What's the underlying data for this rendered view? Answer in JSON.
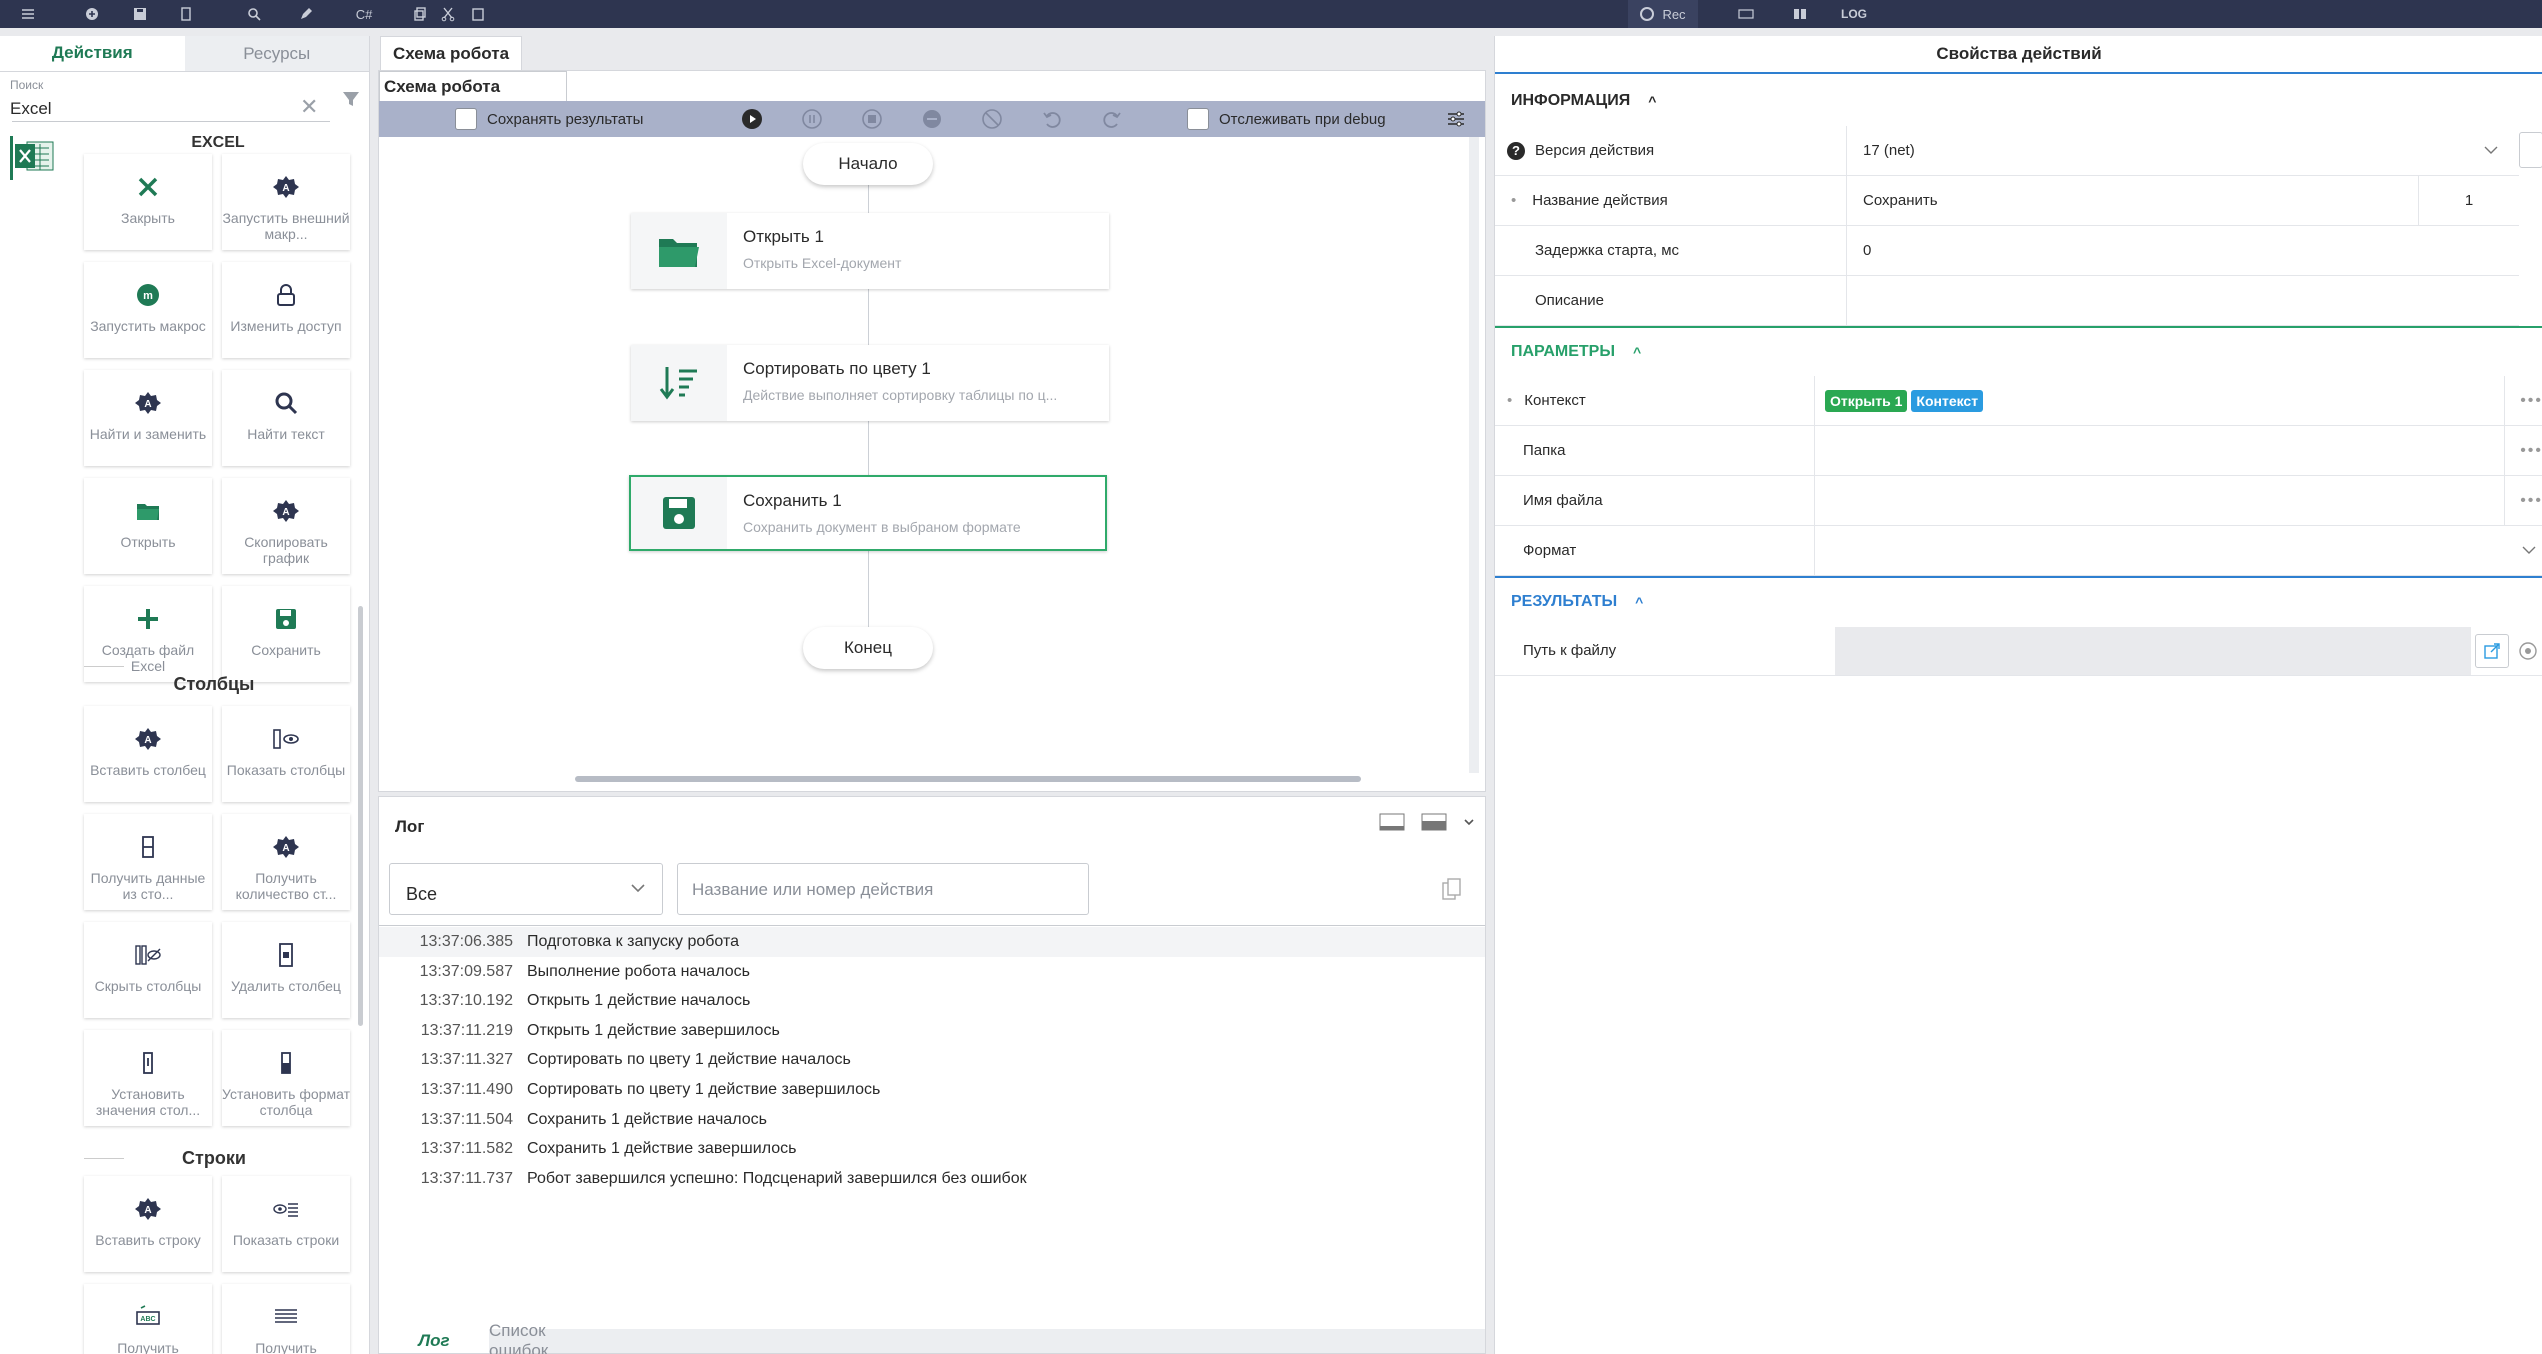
{
  "toolbar": {
    "csharp_label": "C#",
    "rec_label": "Rec",
    "log_label": "LOG"
  },
  "left": {
    "tabs": [
      "Действия",
      "Ресурсы"
    ],
    "search_label": "Поиск",
    "search_value": "Excel",
    "group_title": "EXCEL",
    "tiles_main": [
      {
        "label": "Закрыть",
        "icon": "close-icon"
      },
      {
        "label": "Запустить внешний макр...",
        "icon": "gear-icon"
      },
      {
        "label": "Запустить макрос",
        "icon": "macro-icon"
      },
      {
        "label": "Изменить доступ",
        "icon": "lock-icon"
      },
      {
        "label": "Найти и заменить",
        "icon": "gear-icon"
      },
      {
        "label": "Найти текст",
        "icon": "search-icon"
      },
      {
        "label": "Открыть",
        "icon": "folder-icon"
      },
      {
        "label": "Скопировать график",
        "icon": "gear-icon"
      },
      {
        "label": "Создать файл Excel",
        "icon": "plus-icon"
      },
      {
        "label": "Сохранить",
        "icon": "save-icon"
      }
    ],
    "section_columns": "Столбцы",
    "tiles_columns": [
      {
        "label": "Вставить столбец",
        "icon": "gear-icon"
      },
      {
        "label": "Показать столбцы",
        "icon": "eye-icon"
      },
      {
        "label": "Получить данные из сто...",
        "icon": "column-icon"
      },
      {
        "label": "Получить количество ст...",
        "icon": "gear-icon"
      },
      {
        "label": "Скрыть столбцы",
        "icon": "eye-off-icon"
      },
      {
        "label": "Удалить столбец",
        "icon": "column-delete-icon"
      },
      {
        "label": "Установить значения стол...",
        "icon": "column-value-icon"
      },
      {
        "label": "Установить формат столбца",
        "icon": "column-format-icon"
      }
    ],
    "section_rows": "Строки",
    "tiles_rows": [
      {
        "label": "Вставить строку",
        "icon": "gear-icon"
      },
      {
        "label": "Показать строки",
        "icon": "eye-rows-icon"
      },
      {
        "label": "Получить",
        "icon": "row-get-icon"
      },
      {
        "label": "Получить",
        "icon": "rows-icon"
      }
    ]
  },
  "center": {
    "tab": "Схема робота",
    "sub_tab": "Схема робота",
    "save_results_label": "Сохранять результаты",
    "debug_label": "Отслеживать при debug",
    "start_label": "Начало",
    "end_label": "Конец",
    "nodes": [
      {
        "title": "Открыть  1",
        "subtitle": "Открыть Excel-документ",
        "icon": "folder-icon"
      },
      {
        "title": "Сортировать по цвету  1",
        "subtitle": "Действие выполняет сортировку таблицы по ц...",
        "icon": "sort-icon"
      },
      {
        "title": "Сохранить  1",
        "subtitle": "Сохранить документ в выбраном формате",
        "icon": "save-icon"
      }
    ]
  },
  "log": {
    "title": "Лог",
    "filter_value": "Все",
    "search_placeholder": "Название или номер действия",
    "entries": [
      {
        "time": "13:37:06.385",
        "text": "Подготовка к запуску робота"
      },
      {
        "time": "13:37:09.587",
        "text": "Выполнение робота началось"
      },
      {
        "time": "13:37:10.192",
        "text": "Открыть 1 действие началось"
      },
      {
        "time": "13:37:11.219",
        "text": "Открыть 1 действие завершилось"
      },
      {
        "time": "13:37:11.327",
        "text": "Сортировать по цвету 1 действие началось"
      },
      {
        "time": "13:37:11.490",
        "text": "Сортировать по цвету 1 действие завершилось"
      },
      {
        "time": "13:37:11.504",
        "text": "Сохранить 1 действие началось"
      },
      {
        "time": "13:37:11.582",
        "text": "Сохранить 1 действие завершилось"
      },
      {
        "time": "13:37:11.737",
        "text": "Робот завершился успешно: Подсценарий завершился без ошибок"
      }
    ],
    "bottom_tabs": [
      "Лог",
      "Список ошибок"
    ]
  },
  "props": {
    "title": "Свойства действий",
    "info_section": "ИНФОРМАЦИЯ",
    "version_label": "Версия действия",
    "version_value": "17 (net)",
    "name_label": "Название действия",
    "name_value": "Сохранить",
    "name_number": "1",
    "delay_label": "Задержка старта, мс",
    "delay_value": "0",
    "desc_label": "Описание",
    "params_section": "ПАРАМЕТРЫ",
    "context_label": "Контекст",
    "context_badge1": "Открыть 1",
    "context_badge2": "Контекст",
    "folder_label": "Папка",
    "filename_label": "Имя файла",
    "format_label": "Формат",
    "results_section": "РЕЗУЛЬТАТЫ",
    "path_label": "Путь к файлу"
  },
  "colors": {
    "accent_green": "#1f7a55",
    "accent_blue": "#2e7fd0",
    "toolbar": "#2e3550",
    "badge_green": "#2aa852",
    "badge_blue": "#2a9be0"
  }
}
